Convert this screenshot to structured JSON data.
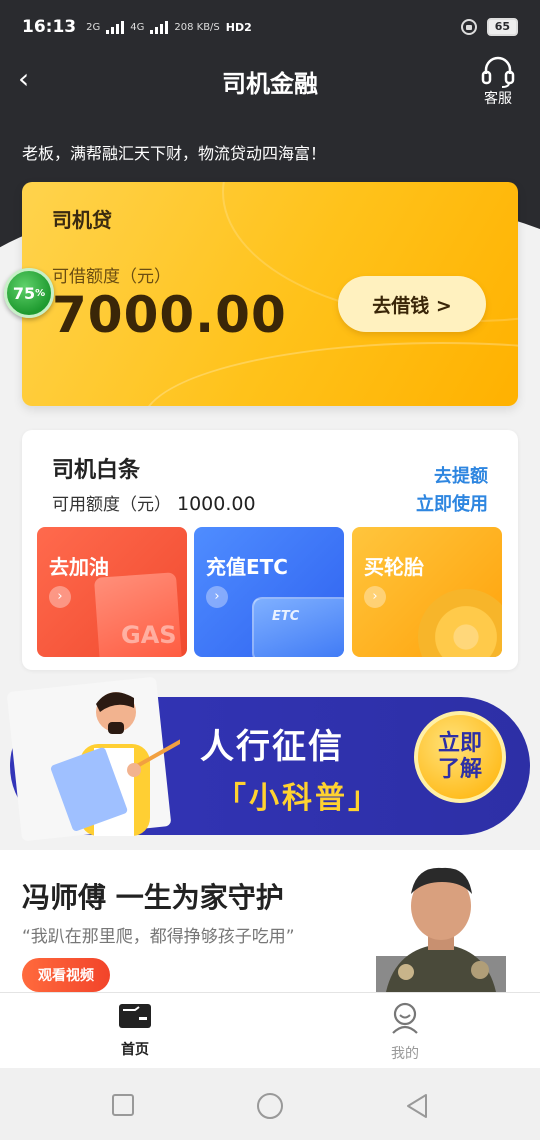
{
  "status_bar": {
    "time": "16:13",
    "net_speed": "208 KB/S",
    "signal_labels": [
      "2G",
      "4G"
    ],
    "hd_label": "HD2",
    "battery": "65"
  },
  "header": {
    "title": "司机金融",
    "service_label": "客服"
  },
  "slogan": "老板，满帮融汇天下财，物流贷动四海富！",
  "loan_card": {
    "name": "司机贷",
    "limit_label": "可借额度（元）",
    "amount": "7000.00",
    "button_label": "去借钱 >"
  },
  "progress_badge": {
    "value": "75",
    "unit": "%"
  },
  "iou_card": {
    "name": "司机白条",
    "limit_label": "可用额度（元）",
    "limit_value": "1000.00",
    "raise_label": "去提额",
    "use_label": "立即使用",
    "tiles": [
      {
        "title": "去加油",
        "art_text": "GAS"
      },
      {
        "title": "充值ETC",
        "art_text": "ETC"
      },
      {
        "title": "买轮胎",
        "art_text": ""
      }
    ]
  },
  "credit_banner": {
    "title": "人行征信",
    "subtitle": "「小科普」",
    "button_line1": "立即",
    "button_line2": "了解"
  },
  "promo": {
    "title": "冯师傅 一生为家守护",
    "quote": "“我趴在那里爬，都得挣够孩子吃用”",
    "button_label": "观看视频"
  },
  "bottom_nav": {
    "items": [
      {
        "label": "首页",
        "active": true
      },
      {
        "label": "我的",
        "active": false
      }
    ]
  },
  "colors": {
    "header_dark": "#2a2b2f",
    "loan_yellow": "#ffc21a",
    "link_blue": "#2e86e0",
    "fuel_red": "#f04a2f",
    "etc_blue": "#2f62f0",
    "tire_orange": "#ffa20a",
    "banner_indigo": "#2d2fa6"
  }
}
